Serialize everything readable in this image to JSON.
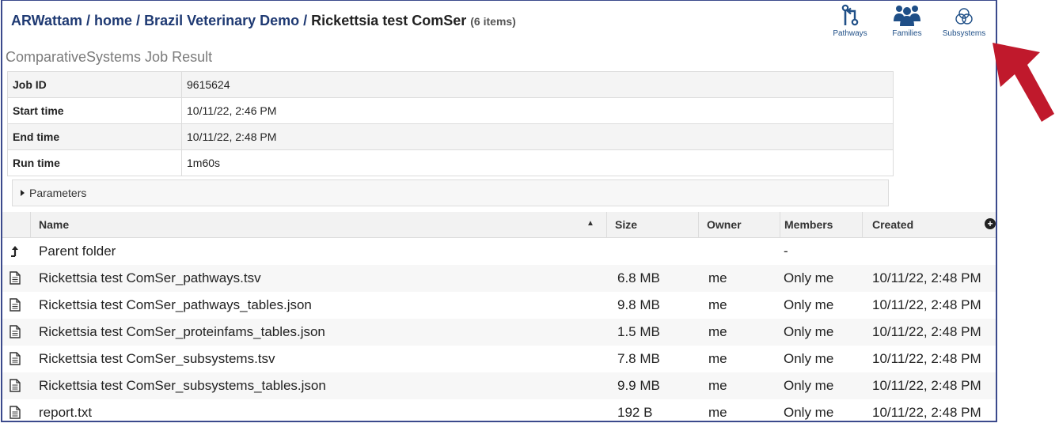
{
  "breadcrumb": {
    "user": "ARWattam",
    "sep1": " / ",
    "home": "home",
    "sep2": " / ",
    "folder": "Brazil Veterinary Demo",
    "sep3": " / ",
    "current": "Rickettsia test ComSer",
    "count": "(6 items)"
  },
  "tools": [
    {
      "label": "Pathways",
      "icon": "pathways-icon"
    },
    {
      "label": "Families",
      "icon": "families-icon"
    },
    {
      "label": "Subsystems",
      "icon": "subsystems-icon"
    }
  ],
  "job": {
    "title": "ComparativeSystems Job Result",
    "rows": [
      {
        "key": "Job ID",
        "value": "9615624"
      },
      {
        "key": "Start time",
        "value": "10/11/22, 2:46 PM"
      },
      {
        "key": "End time",
        "value": "10/11/22, 2:48 PM"
      },
      {
        "key": "Run time",
        "value": "1m60s"
      }
    ],
    "parameters_label": "Parameters"
  },
  "grid": {
    "headers": {
      "name": "Name",
      "size": "Size",
      "owner": "Owner",
      "members": "Members",
      "created": "Created"
    },
    "sort_indicator": "▲",
    "parent": {
      "name": "Parent folder",
      "members": "-"
    },
    "files": [
      {
        "name": "Rickettsia test ComSer_pathways.tsv",
        "size": "6.8 MB",
        "owner": "me",
        "members": "Only me",
        "created": "10/11/22, 2:48 PM"
      },
      {
        "name": "Rickettsia test ComSer_pathways_tables.json",
        "size": "9.8 MB",
        "owner": "me",
        "members": "Only me",
        "created": "10/11/22, 2:48 PM"
      },
      {
        "name": "Rickettsia test ComSer_proteinfams_tables.json",
        "size": "1.5 MB",
        "owner": "me",
        "members": "Only me",
        "created": "10/11/22, 2:48 PM"
      },
      {
        "name": "Rickettsia test ComSer_subsystems.tsv",
        "size": "7.8 MB",
        "owner": "me",
        "members": "Only me",
        "created": "10/11/22, 2:48 PM"
      },
      {
        "name": "Rickettsia test ComSer_subsystems_tables.json",
        "size": "9.9 MB",
        "owner": "me",
        "members": "Only me",
        "created": "10/11/22, 2:48 PM"
      },
      {
        "name": "report.txt",
        "size": "192 B",
        "owner": "me",
        "members": "Only me",
        "created": "10/11/22, 2:48 PM"
      }
    ]
  },
  "colors": {
    "accent": "#1f3a73",
    "annotation_arrow": "#c0192c",
    "border": "#3b4a8c"
  }
}
